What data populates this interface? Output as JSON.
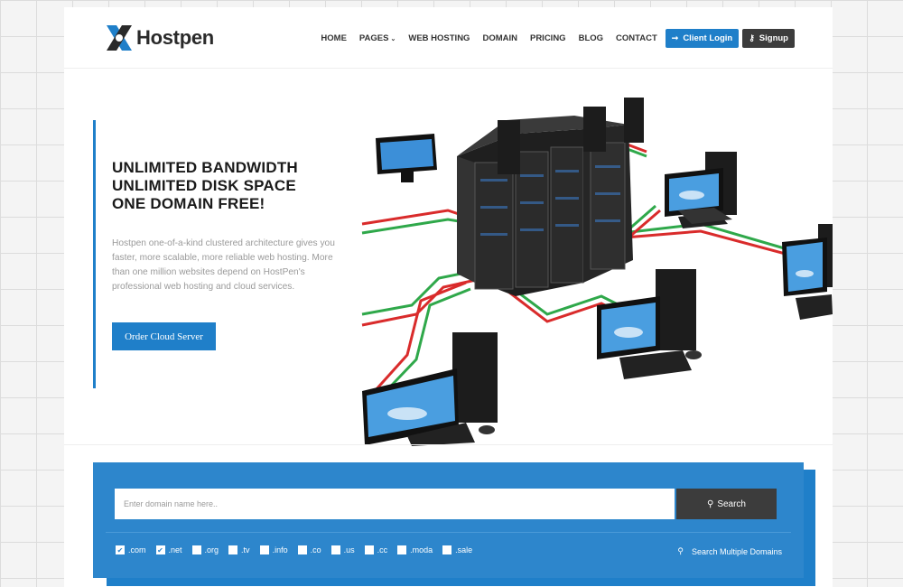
{
  "brand": {
    "name": "Hostpen"
  },
  "nav": {
    "items": [
      "HOME",
      "PAGES",
      "WEB HOSTING",
      "DOMAIN",
      "PRICING",
      "BLOG",
      "CONTACT"
    ],
    "client_login": "Client Login",
    "signup": "Signup"
  },
  "hero": {
    "headline": [
      "UNLIMITED BANDWIDTH",
      "UNLIMITED DISK SPACE",
      "ONE DOMAIN FREE!"
    ],
    "description": "Hostpen one-of-a-kind clustered architecture gives you faster, more scalable, more reliable web hosting. More than one million websites depend on HostPen's professional web hosting and cloud services.",
    "cta": "Order Cloud Server"
  },
  "domain_search": {
    "placeholder": "Enter domain name here..",
    "search_label": "Search",
    "tlds": [
      {
        "label": ".com",
        "checked": true
      },
      {
        "label": ".net",
        "checked": true
      },
      {
        "label": ".org",
        "checked": false
      },
      {
        "label": ".tv",
        "checked": false
      },
      {
        "label": ".info",
        "checked": false
      },
      {
        "label": ".co",
        "checked": false
      },
      {
        "label": ".us",
        "checked": false
      },
      {
        "label": ".cc",
        "checked": false
      },
      {
        "label": ".moda",
        "checked": false
      },
      {
        "label": ".sale",
        "checked": false
      }
    ],
    "multiple_label": "Search Multiple Domains"
  },
  "colors": {
    "accent": "#1f7fc9",
    "dark": "#3c3c3c",
    "panel": "#2d86cc"
  }
}
